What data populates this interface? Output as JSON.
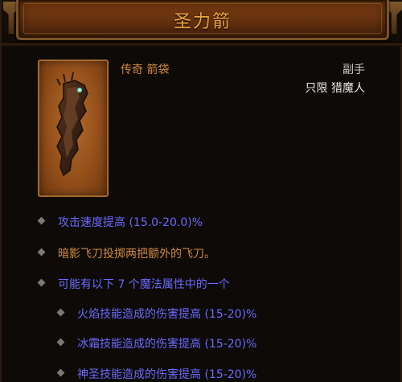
{
  "title": "圣力箭",
  "item_type": "传奇 箭袋",
  "slot": "副手",
  "class_requirement": "只限 猎魔人",
  "affixes": [
    {
      "text": "攻击速度提高 (15.0-20.0)%"
    },
    {
      "text": "暗影飞刀投掷两把额外的飞刀。"
    },
    {
      "text": "可能有以下 7 个魔法属性中的一个"
    }
  ],
  "sub_affixes": [
    {
      "text": "火焰技能造成的伤害提高 (15-20)%"
    },
    {
      "text": "冰霜技能造成的伤害提高 (15-20)%"
    },
    {
      "text": "神圣技能造成的伤害提高 (15-20)%"
    }
  ],
  "colors": {
    "title": "#e7a13d",
    "legendary": "#d18a3a",
    "magic": "#6a6aff",
    "white": "#e5e5e5"
  },
  "icons": {
    "item": "quiver-icon",
    "bullet": "diamond-bullet-icon"
  }
}
